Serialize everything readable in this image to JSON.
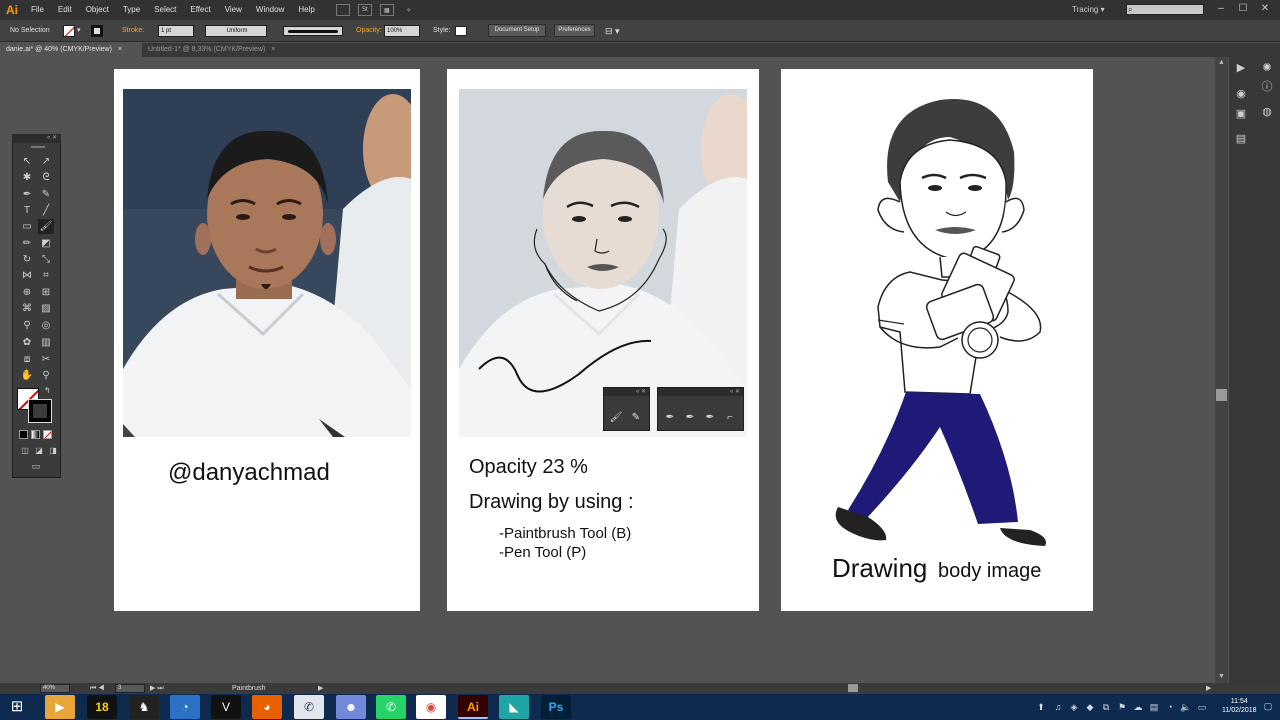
{
  "menubar": {
    "logo": "Ai",
    "items": [
      "File",
      "Edit",
      "Object",
      "Type",
      "Select",
      "Effect",
      "View",
      "Window",
      "Help"
    ],
    "extra": [
      "St",
      "▦"
    ],
    "tracing_label": "Tracing",
    "window_controls": [
      "–",
      "☐",
      "✕"
    ]
  },
  "controlbar": {
    "selection": "No Selection",
    "stroke_label": "Stroke:",
    "stroke_weight": "1 pt",
    "profile": "Uniform",
    "opacity_label": "Opacity:",
    "opacity_value": "100%",
    "style_label": "Style:",
    "document_setup": "Document Setup",
    "preferences": "Preferences"
  },
  "tabs": [
    {
      "label": "danie.ai* @ 40% (CMYK/Preview)",
      "close": "×"
    },
    {
      "label": "Untitled-1* @ 8,33% (CMYK/Preview)",
      "close": "×"
    }
  ],
  "artboard_1": {
    "handle": "@danyachmad"
  },
  "artboard_2": {
    "opacity": "Opacity 23 %",
    "drawing_by": "Drawing by using :",
    "tools": [
      "-Paintbrush Tool (B)",
      "-Pen Tool (P)"
    ]
  },
  "artboard_3": {
    "caption_big": "Drawing",
    "caption_small": "body image"
  },
  "statusbar": {
    "zoom": "40%",
    "page": "3",
    "tool": "Paintbrush"
  },
  "taskbar": {
    "time": "11:54",
    "date": "11/02/2018",
    "apps": [
      "18",
      "Ai",
      "Ps"
    ]
  },
  "colors": {
    "accent_orange": "#f5a623",
    "pants_navy": "#1f1a77",
    "taskbar": "#0f2a4f"
  }
}
